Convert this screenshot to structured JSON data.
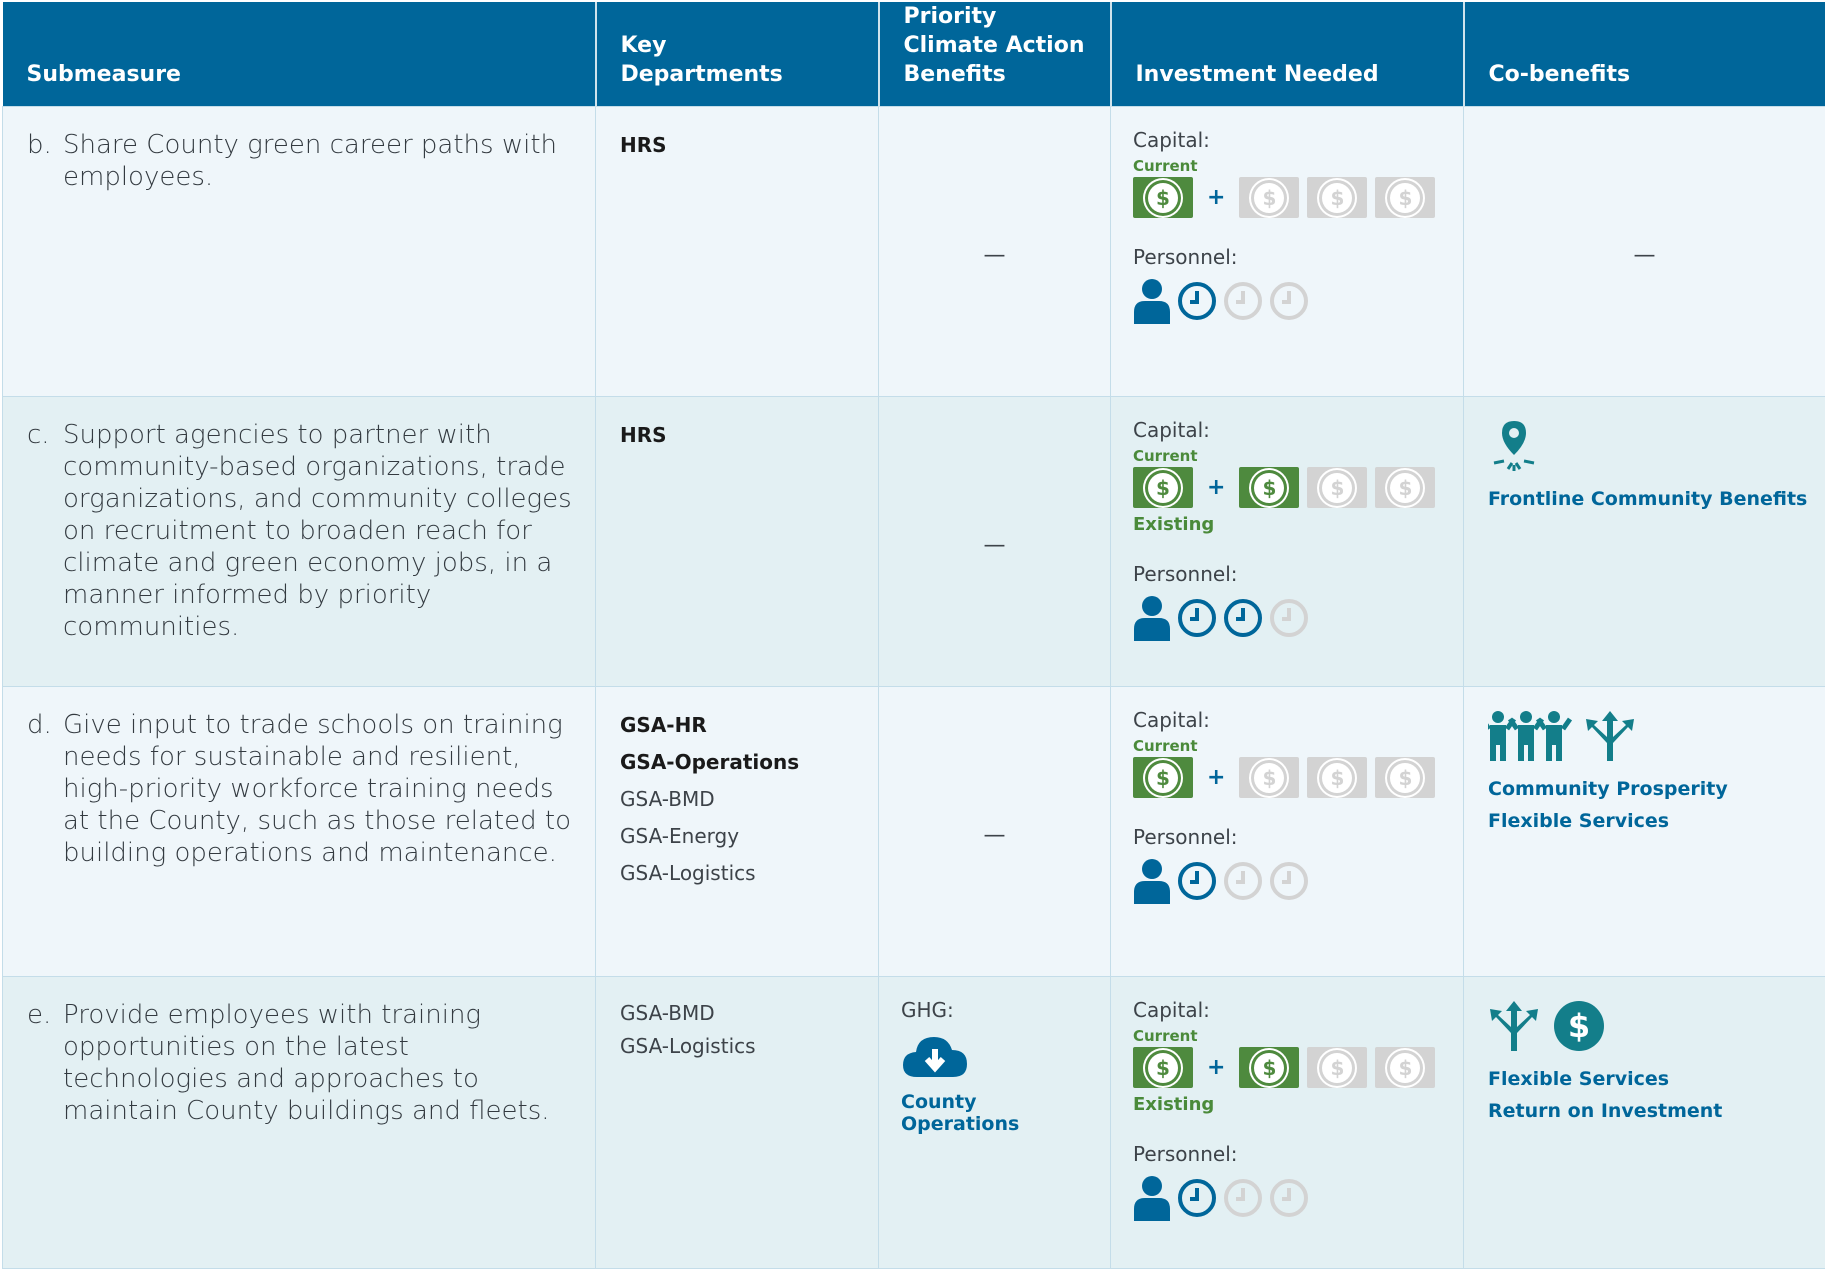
{
  "header": {
    "submeasure": "Submeasure",
    "key_departments": "Key Departments",
    "priority_benefits": "Priority Climate Action Benefits",
    "investment_needed": "Investment Needed",
    "co_benefits": "Co-benefits"
  },
  "labels": {
    "capital": "Capital:",
    "current": "Current",
    "existing": "Existing",
    "personnel": "Personnel:",
    "plus": "+",
    "dash": "—",
    "ghg": "GHG:",
    "dollar": "$"
  },
  "rows": [
    {
      "letter": "b.",
      "text": "Share County green career paths with employees.",
      "departments_lead": [
        "HRS"
      ],
      "departments_other": [],
      "priority": "—",
      "capital_current_filled": 1,
      "capital_additional_filled": 0,
      "capital_total_additional": 3,
      "personnel_filled": 1,
      "personnel_total": 3,
      "co_benefits": [],
      "co_benefit_icons": []
    },
    {
      "letter": "c.",
      "text": "Support agencies to partner with community-based organizations, trade organizations, and community colleges on recruitment to broaden reach for climate and green economy jobs, in a manner informed by priority communities.",
      "departments_lead": [
        "HRS"
      ],
      "departments_other": [],
      "priority": "—",
      "capital_current_filled": 1,
      "capital_additional_filled": 1,
      "capital_total_additional": 3,
      "personnel_filled": 2,
      "personnel_total": 3,
      "co_benefits": [
        "Frontline Community Benefits"
      ],
      "co_benefit_icons": [
        "location-pin-icon"
      ]
    },
    {
      "letter": "d.",
      "text": "Give input to trade schools on training needs for sustainable and resilient, high-priority workforce training needs at the County, such as those related to building operations and maintenance.",
      "departments_lead": [
        "GSA-HR",
        "GSA-Operations"
      ],
      "departments_other": [
        "GSA-BMD",
        "GSA-Energy",
        "GSA-Logistics"
      ],
      "priority": "—",
      "capital_current_filled": 1,
      "capital_additional_filled": 0,
      "capital_total_additional": 3,
      "personnel_filled": 1,
      "personnel_total": 3,
      "co_benefits": [
        "Community Prosperity",
        "Flexible Services"
      ],
      "co_benefit_icons": [
        "people-group-icon",
        "split-arrows-icon"
      ]
    },
    {
      "letter": "e.",
      "text": "Provide employees with training opportunities on the latest technologies and approaches to maintain County buildings and fleets.",
      "departments_lead": [],
      "departments_other": [
        "GSA-BMD",
        "GSA-Logistics"
      ],
      "priority_ghg": "County Operations",
      "capital_current_filled": 1,
      "capital_additional_filled": 1,
      "capital_total_additional": 3,
      "personnel_filled": 1,
      "personnel_total": 3,
      "co_benefits": [
        "Flexible Services",
        "Return on Investment"
      ],
      "co_benefit_icons": [
        "split-arrows-icon",
        "dollar-circle-icon"
      ]
    }
  ],
  "colors": {
    "header_bg": "#00669a",
    "accent_blue": "#00669a",
    "money_green": "#4e8a3e",
    "inactive_gray": "#d3d3d3",
    "row_odd": "#eff6fa",
    "row_even": "#e3f0f3"
  }
}
